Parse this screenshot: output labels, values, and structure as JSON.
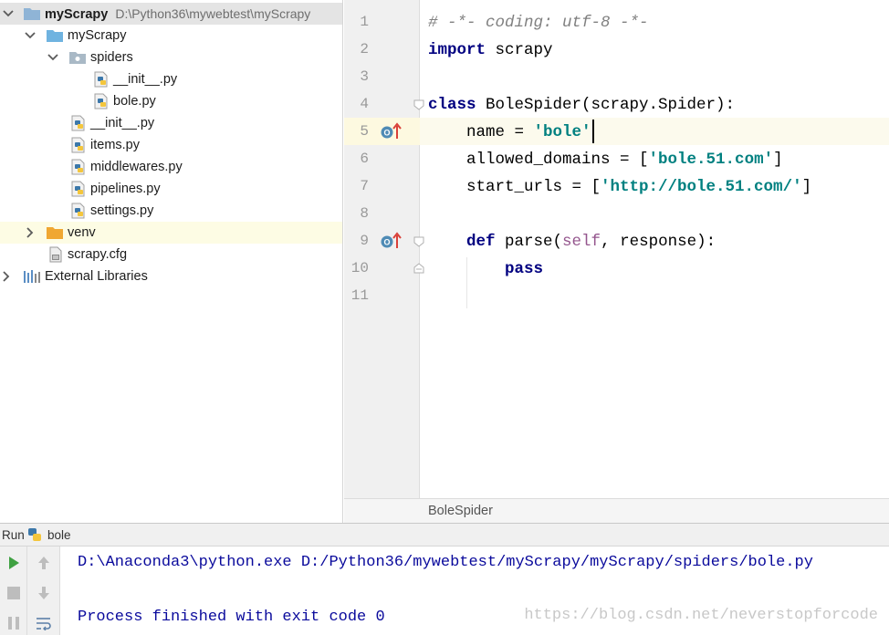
{
  "project_tree": {
    "root": {
      "name": "myScrapy",
      "path": "D:\\Python36\\mywebtest\\myScrapy"
    },
    "items": [
      {
        "label": "myScrapy"
      },
      {
        "label": "spiders"
      },
      {
        "label": "__init__.py"
      },
      {
        "label": "bole.py"
      },
      {
        "label": "__init__.py"
      },
      {
        "label": "items.py"
      },
      {
        "label": "middlewares.py"
      },
      {
        "label": "pipelines.py"
      },
      {
        "label": "settings.py"
      },
      {
        "label": "venv"
      },
      {
        "label": "scrapy.cfg"
      },
      {
        "label": "External Libraries"
      }
    ]
  },
  "editor": {
    "line_numbers": [
      "1",
      "2",
      "3",
      "4",
      "5",
      "6",
      "7",
      "8",
      "9",
      "10",
      "11"
    ],
    "code": {
      "l1_comment": "# -*- coding: utf-8 -*-",
      "l2_import_kw": "import",
      "l2_module": " scrapy",
      "l4_class_kw": "class",
      "l4_rest": " BoleSpider(scrapy.Spider):",
      "l5_name": "    name = ",
      "l5_value": "'bole'",
      "l6_name": "    allowed_domains = [",
      "l6_value": "'bole.51.com'",
      "l6_end": "]",
      "l7_name": "    start_urls = [",
      "l7_value": "'http://bole.51.com/'",
      "l7_end": "]",
      "l9_indent": "    ",
      "l9_def_kw": "def",
      "l9_func": " parse(",
      "l9_self": "self",
      "l9_rest": ", response):",
      "l10_indent": "        ",
      "l10_pass_kw": "pass"
    },
    "breadcrumb": "BoleSpider"
  },
  "run": {
    "tab_label": "Run",
    "config_name": "bole",
    "console": [
      "D:\\Anaconda3\\python.exe D:/Python36/mywebtest/myScrapy/myScrapy/spiders/bole.py",
      "Process finished with exit code 0"
    ],
    "watermark": "https://blog.csdn.net/neverstopforcode"
  },
  "colors": {
    "keyword": "#000080",
    "string": "#008080",
    "comment": "#808080",
    "self": "#94558d",
    "console_text": "#0a0a9c",
    "run_green": "#3fa142"
  },
  "icons": [
    "folder-icon",
    "package-folder-icon",
    "python-file-icon",
    "config-file-icon",
    "libraries-icon",
    "override-method-icon",
    "run-icon",
    "stop-icon",
    "pause-icon",
    "scroll-up-icon",
    "scroll-down-icon",
    "soft-wrap-icon"
  ]
}
